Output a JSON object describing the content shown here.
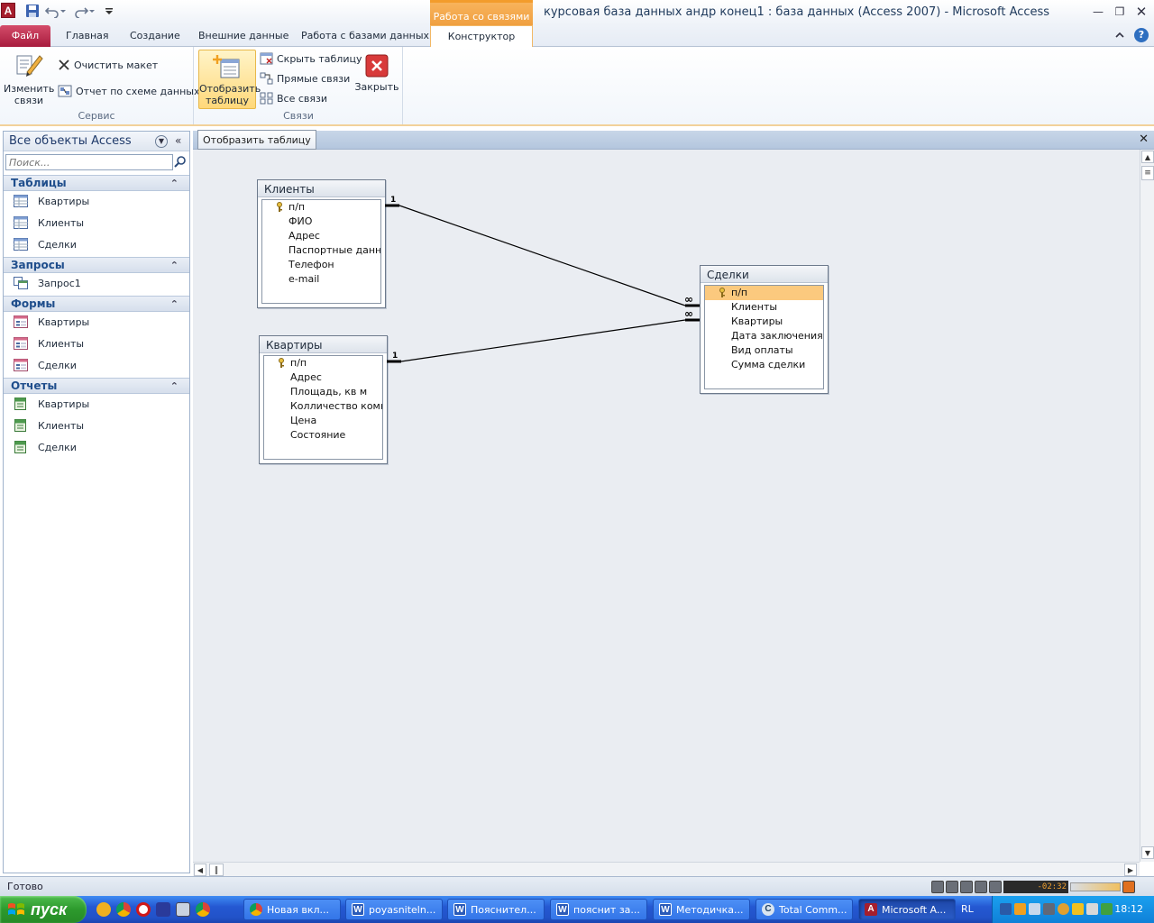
{
  "app": {
    "icon_letter": "A",
    "window_title": "курсовая база данных андр конец1 : база данных (Access 2007)  -  Microsoft Access",
    "context_tab_title": "Работа со связями"
  },
  "ribbon_tabs": {
    "file": "Файл",
    "home": "Главная",
    "create": "Создание",
    "external": "Внешние данные",
    "dbtools": "Работа с базами данных",
    "design": "Конструктор"
  },
  "ribbon": {
    "edit_relations": "Изменить связи",
    "clear_layout": "Очистить макет",
    "relationship_report": "Отчет по схеме данных",
    "group_tools": "Сервис",
    "show_table": "Отобразить таблицу",
    "hide_table": "Скрыть таблицу",
    "direct_relationships": "Прямые связи",
    "all_relationships": "Все связи",
    "close": "Закрыть",
    "group_relationships": "Связи"
  },
  "nav": {
    "title": "Все объекты Access",
    "search_placeholder": "Поиск...",
    "sections": [
      {
        "label": "Таблицы",
        "items": [
          "Квартиры",
          "Клиенты",
          "Сделки"
        ]
      },
      {
        "label": "Запросы",
        "items": [
          "Запрос1"
        ]
      },
      {
        "label": "Формы",
        "items": [
          "Квартиры",
          "Клиенты",
          "Сделки"
        ]
      },
      {
        "label": "Отчеты",
        "items": [
          "Квартиры",
          "Клиенты",
          "Сделки"
        ]
      }
    ]
  },
  "tooltip": "Отобразить таблицу",
  "tables": {
    "clients": {
      "title": "Клиенты",
      "fields": [
        "п/п",
        "ФИО",
        "Адрес",
        "Паспортные данные",
        "Телефон",
        "e-mail"
      ]
    },
    "apartments": {
      "title": "Квартиры",
      "fields": [
        "п/п",
        "Адрес",
        "Площадь, кв м",
        "Колличество комнат",
        "Цена",
        "Состояние"
      ]
    },
    "deals": {
      "title": "Сделки",
      "fields": [
        "п/п",
        "Клиенты",
        "Квартиры",
        "Дата заключения договора",
        "Вид оплаты",
        "Сумма сделки"
      ]
    }
  },
  "relations": {
    "one": "1",
    "many": "∞"
  },
  "status": {
    "text": "Готово",
    "player_time": "-02:32"
  },
  "taskbar": {
    "start": "пуск",
    "tasks": [
      "Новая вкл...",
      "poyasniteln...",
      "Пояснител...",
      "пояснит за...",
      "Методичка...",
      "Total Comm...",
      "Microsoft A..."
    ],
    "lang": "RL",
    "clock": "18:12"
  },
  "colors": {
    "file_tab": "#c02e50",
    "context_tab": "#f4a64a",
    "selected_field": "#fbc97e",
    "taskbar": "#2458d2",
    "start_button": "#2d9a2d"
  }
}
